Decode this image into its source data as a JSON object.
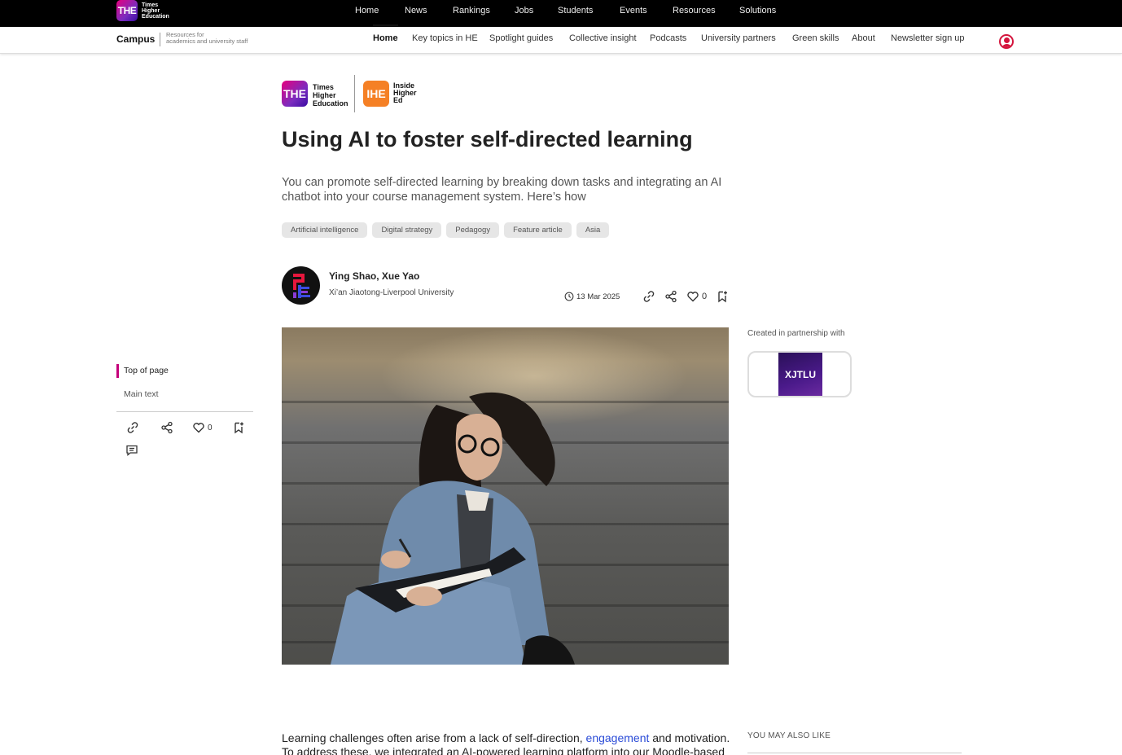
{
  "brand": {
    "badge": "THE",
    "words": [
      "Times",
      "Higher",
      "Education"
    ]
  },
  "topnav": [
    "Home",
    "News",
    "Rankings",
    "Jobs",
    "Students",
    "Events",
    "Resources",
    "Solutions"
  ],
  "campus": {
    "title": "Campus",
    "subtitle_line1": "Resources for",
    "subtitle_line2": "academics and university staff"
  },
  "subnav": [
    "Home",
    "Key topics in HE",
    "Spotlight guides",
    "Collective insight",
    "Podcasts",
    "University partners",
    "Green skills",
    "About",
    "Newsletter sign up"
  ],
  "partner_logos": {
    "the_badge": "THE",
    "the_words": [
      "Times",
      "Higher",
      "Education"
    ],
    "ihe_badge": "IHE",
    "ihe_words": [
      "Inside",
      "Higher",
      "Ed"
    ]
  },
  "article": {
    "title": "Using AI to foster self-directed learning",
    "standfirst": "You can promote self-directed learning by breaking down tasks and integrating an AI chatbot into your course management system. Here’s how",
    "tags": [
      "Artificial intelligence",
      "Digital strategy",
      "Pedagogy",
      "Feature article",
      "Asia"
    ],
    "authors": "Ying Shao, Xue Yao",
    "institution": "Xi’an Jiaotong-Liverpool University",
    "date": "13 Mar 2025",
    "likes": "0",
    "body_before_link": "Learning challenges often arise from a lack of self-direction, ",
    "body_link": "engagement",
    "body_after_link": " and motivation.",
    "body_line2": "To address these, we integrated an AI-powered learning platform into our Moodle-based"
  },
  "toc": {
    "top": "Top of page",
    "main": "Main text",
    "likes": "0"
  },
  "partner": {
    "label": "Created in partnership with",
    "logo_text": "XJTLU"
  },
  "sidebar": {
    "also_like": "YOU MAY ALSO LIKE"
  },
  "colors": {
    "accent_magenta": "#c5007a",
    "link_blue": "#2a4bd7",
    "user_red": "#d4143c",
    "ihe_orange": "#f58025"
  }
}
